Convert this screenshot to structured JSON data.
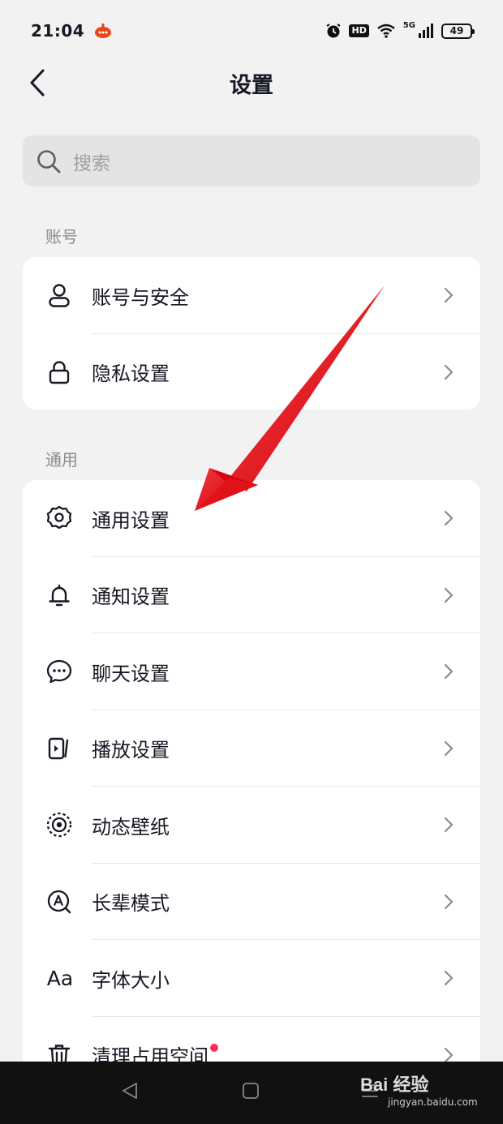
{
  "status_bar": {
    "time": "21:04",
    "hd_label": "HD",
    "network_label": "5G",
    "battery_level": "49"
  },
  "header": {
    "title": "设置",
    "back_icon": "chevron-left-icon"
  },
  "search": {
    "placeholder": "搜索",
    "icon": "search-icon"
  },
  "sections": [
    {
      "label": "账号",
      "items": [
        {
          "label": "账号与安全",
          "icon": "user-icon"
        },
        {
          "label": "隐私设置",
          "icon": "lock-icon"
        }
      ]
    },
    {
      "label": "通用",
      "items": [
        {
          "label": "通用设置",
          "icon": "gear-icon"
        },
        {
          "label": "通知设置",
          "icon": "bell-icon"
        },
        {
          "label": "聊天设置",
          "icon": "chat-bubble-icon"
        },
        {
          "label": "播放设置",
          "icon": "play-screen-icon"
        },
        {
          "label": "动态壁纸",
          "icon": "wallpaper-icon"
        },
        {
          "label": "长辈模式",
          "icon": "elder-mode-icon"
        },
        {
          "label": "字体大小",
          "icon": "font-size-icon",
          "glyph": "Aa"
        },
        {
          "label": "清理占用空间",
          "icon": "trash-icon",
          "badge": "red-dot"
        }
      ]
    }
  ],
  "annotation": {
    "type": "red-arrow",
    "points_to": "通用设置",
    "color": "#e8141b"
  },
  "watermark": {
    "brand": "Bai  经验",
    "url": "jingyan.baidu.com"
  },
  "colors": {
    "background": "#f2f2f2",
    "card": "#ffffff",
    "text": "#161823",
    "secondary": "#8a8b91",
    "badge": "#fe2c55"
  }
}
